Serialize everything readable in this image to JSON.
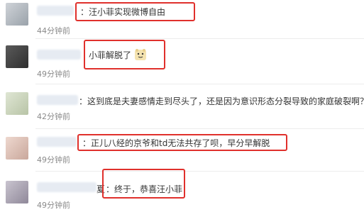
{
  "comments": [
    {
      "sep": "：",
      "text": "汪小菲实现微博自由",
      "time": "44分钟前"
    },
    {
      "sep": "",
      "text": "小菲解脱了",
      "sticker": "bear-emoji-icon",
      "time": "49分钟前"
    },
    {
      "sep": "：",
      "text": "这到底是夫妻感情走到尽头了，还是因为意识形态分裂导致的家庭破裂啊？",
      "time": "42分钟前"
    },
    {
      "sep": "：",
      "text": "正儿八经的京爷和td无法共存了呗，早分早解脱",
      "time": "49分钟前"
    },
    {
      "name_tail": "夏",
      "sep": "：",
      "text": "终于，恭喜汪小菲",
      "time": "49分钟前"
    }
  ],
  "colors": {
    "highlight": "#e0302c",
    "time": "#8a8a8a"
  }
}
